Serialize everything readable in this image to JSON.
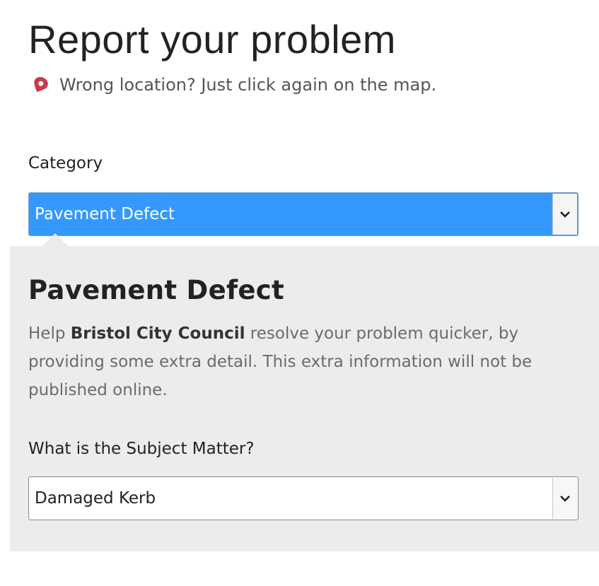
{
  "header": {
    "title": "Report your problem",
    "wrong_location": "Wrong location? Just click again on the map."
  },
  "category": {
    "label": "Category",
    "selected": "Pavement Defect"
  },
  "details_panel": {
    "heading": "Pavement Defect",
    "help_prefix": "Help ",
    "help_council": "Bristol City Council",
    "help_suffix": " resolve your problem quicker, by providing some extra detail. This extra information will not be published online.",
    "subject_label": "What is the Subject Matter?",
    "subject_selected": "Damaged Kerb"
  },
  "colors": {
    "selected_bg": "#3399ff",
    "panel_bg": "#ececec",
    "pin": "#c83a4a"
  },
  "icons": {
    "pin": "map-pin-icon",
    "dropdown": "chevron-down-icon"
  }
}
